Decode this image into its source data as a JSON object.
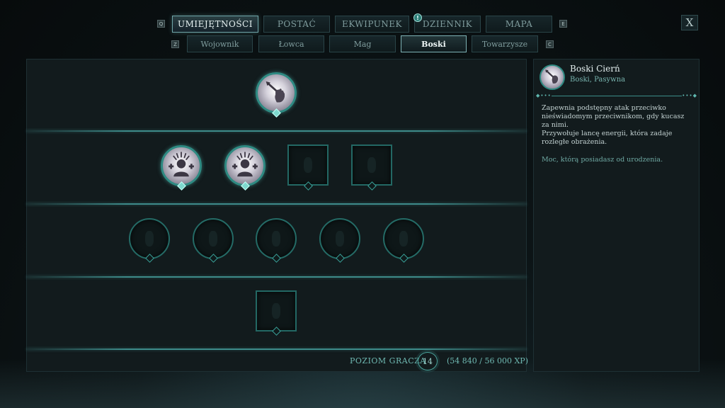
{
  "nav": {
    "tabs": [
      {
        "label": "UMIEJĘTNOŚCI"
      },
      {
        "label": "POSTAĆ"
      },
      {
        "label": "EKWIPUNEK"
      },
      {
        "label": "DZIENNIK"
      },
      {
        "label": "MAPA"
      }
    ],
    "active_tab": "UMIEJĘTNOŚCI",
    "prev_key": "Q",
    "next_key": "E",
    "journal_badge": "!",
    "close_label": "X"
  },
  "subnav": {
    "tabs": [
      {
        "label": "Wojownik"
      },
      {
        "label": "Łowca"
      },
      {
        "label": "Mag"
      },
      {
        "label": "Boski"
      },
      {
        "label": "Towarzysze"
      }
    ],
    "active_tab": "Boski",
    "prev_key": "Z",
    "next_key": "C"
  },
  "skill_tree": {
    "tiers": [
      {
        "nodes": [
          {
            "shape": "circle",
            "state": "unlocked",
            "icon": "hand-spear-icon"
          }
        ]
      },
      {
        "nodes": [
          {
            "shape": "circle",
            "state": "unlocked",
            "icon": "figure-plus-icon"
          },
          {
            "shape": "circle",
            "state": "unlocked",
            "icon": "figure-plus-icon"
          },
          {
            "shape": "square",
            "state": "locked",
            "icon": "locked-skill-icon"
          },
          {
            "shape": "square",
            "state": "locked",
            "icon": "locked-skill-icon"
          }
        ]
      },
      {
        "nodes": [
          {
            "shape": "circle",
            "state": "locked",
            "icon": "locked-skill-icon"
          },
          {
            "shape": "circle",
            "state": "locked",
            "icon": "locked-skill-icon"
          },
          {
            "shape": "circle",
            "state": "locked",
            "icon": "locked-skill-icon"
          },
          {
            "shape": "circle",
            "state": "locked",
            "icon": "locked-skill-icon"
          },
          {
            "shape": "circle",
            "state": "locked",
            "icon": "locked-skill-icon"
          }
        ]
      },
      {
        "nodes": [
          {
            "shape": "square",
            "state": "locked",
            "icon": "locked-skill-icon"
          }
        ]
      }
    ]
  },
  "footer": {
    "level_label": "POZIOM GRACZA",
    "level": "14",
    "xp": "(54 840 / 56 000 XP)"
  },
  "detail": {
    "icon": "hand-spear-icon",
    "title": "Boski Cierń",
    "subtitle": "Boski, Pasywna",
    "description_1": "Zapewnia podstępny atak przeciwko nieświadomym przeciwnikom, gdy kucasz za nimi.",
    "description_2": "Przywołuje lancę energii, która zadaje rozległe obrażenia.",
    "flavor": "Moc, którą posiadasz od urodzenia."
  },
  "colors": {
    "accent": "#3d8b8a",
    "active_border": "#7eb3b6",
    "panel_bg": "#121b1d"
  }
}
